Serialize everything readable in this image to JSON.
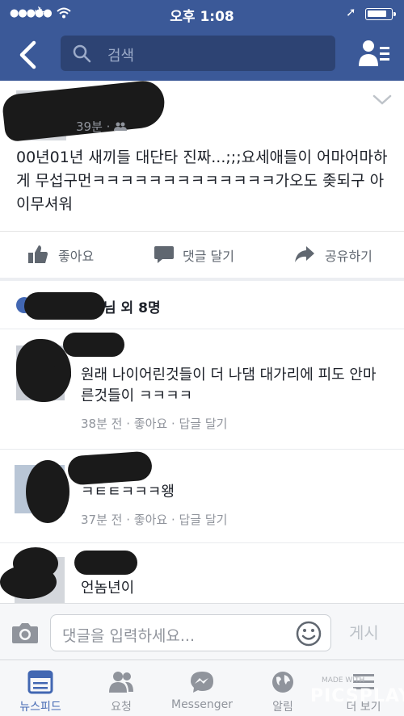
{
  "status_bar": {
    "time": "오후 1:08",
    "battery_level": 0.85
  },
  "header": {
    "search_placeholder": "검색",
    "icons": [
      "back-icon",
      "search-icon",
      "friends-list-icon"
    ]
  },
  "post": {
    "time": "39분 ·",
    "audience_icon": "friends-icon",
    "text": "00년01년 새끼들 대단타 진짜...;;;요세애들이 어마어마하게 무섭구먼ㅋㅋㅋㅋㅋㅋㅋㅋㅋㅋㅋㅋㅋ가오도 좆되구 아이무셔워",
    "actions": {
      "like": "좋아요",
      "comment": "댓글 달기",
      "share": "공유하기"
    },
    "likers_suffix": "님 외 8명"
  },
  "comments": [
    {
      "text": "원래 나이어린것들이 더 나댐 대가리에 피도 안마른것들이 ㅋㅋㅋㅋ",
      "time": "38분 전",
      "like": "좋아요",
      "reply": "답글 달기"
    },
    {
      "text": "ㅋㅌㅌㅋㅋㅋ왱",
      "time": "37분 전",
      "like": "좋아요",
      "reply": "답글 달기"
    },
    {
      "text": "언놈년이"
    }
  ],
  "compose": {
    "placeholder": "댓글을 입력하세요...",
    "post_label": "게시"
  },
  "tabs": [
    {
      "label": "뉴스피드",
      "icon": "news-feed-icon",
      "active": true
    },
    {
      "label": "요청",
      "icon": "friend-requests-icon",
      "active": false
    },
    {
      "label": "Messenger",
      "icon": "messenger-icon",
      "active": false
    },
    {
      "label": "알림",
      "icon": "notifications-globe-icon",
      "active": false
    },
    {
      "label": "더 보기",
      "icon": "more-menu-icon",
      "active": false
    }
  ],
  "watermark": "PICSPLAY",
  "watermark_small": "MADE WITH",
  "colors": {
    "brand_blue": "#3b5998",
    "active_tab": "#4267b2",
    "meta_gray": "#90949c"
  }
}
